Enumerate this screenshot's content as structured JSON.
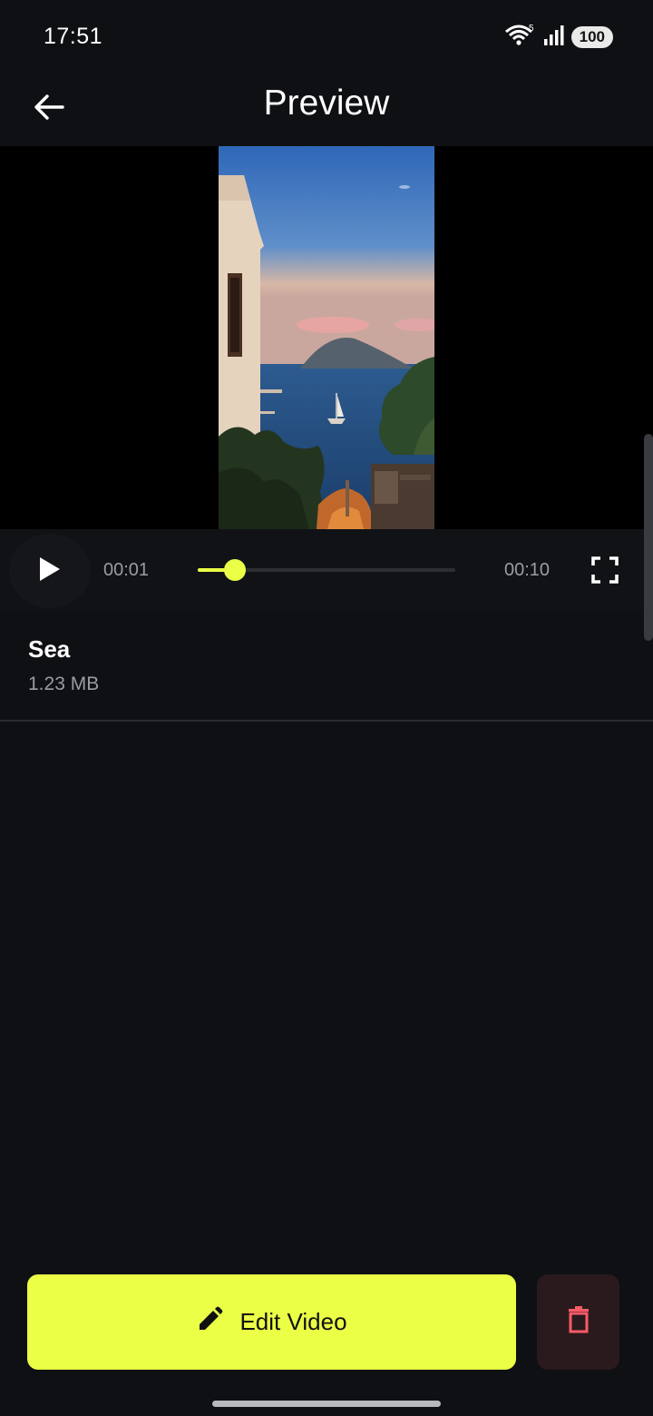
{
  "status_bar": {
    "time": "17:51",
    "wifi_badge": "5",
    "battery": "100",
    "icons": [
      "wifi-icon",
      "signal-icon",
      "battery-icon"
    ]
  },
  "app_bar": {
    "title": "Preview",
    "back_icon": "arrow-back-icon"
  },
  "player": {
    "thumbnail_description": "sea",
    "current_time": "00:01",
    "total_time": "00:10",
    "progress_fraction": 0.145,
    "play_icon": "play-icon",
    "fullscreen_icon": "fullscreen-icon"
  },
  "file": {
    "name": "Sea",
    "size": "1.23 MB"
  },
  "actions": {
    "edit_label": "Edit Video",
    "edit_icon": "pencil-icon",
    "delete_icon": "trash-icon"
  },
  "colors": {
    "accent": "#eaff46",
    "background": "#0f1013",
    "delete_bg": "#2a1a1d",
    "delete_icon": "#ff5b67"
  }
}
